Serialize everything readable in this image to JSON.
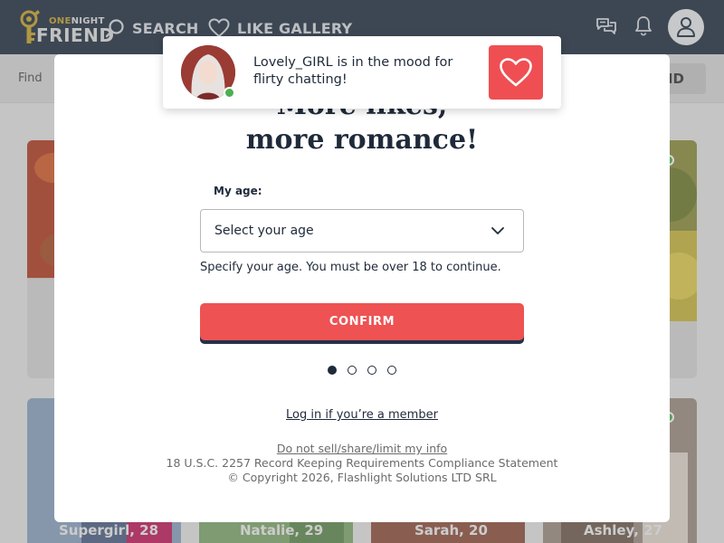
{
  "brand": {
    "logo_top_a": "ONE",
    "logo_top_b": "NIGHT",
    "logo_bottom": "FRIEND"
  },
  "nav": {
    "search_label": "SEARCH",
    "like_gallery_label": "LIKE GALLERY",
    "icons": [
      "search-icon",
      "heart-icon",
      "chat-icon",
      "bell-icon",
      "user-icon"
    ]
  },
  "subbar": {
    "find_label": "Find",
    "button_label_partial": "ID"
  },
  "cards": [
    {
      "name": "",
      "sub": ""
    },
    {
      "name": "",
      "sub": ""
    },
    {
      "name": "Supergirl, 28",
      "sub": ""
    },
    {
      "name": "Natalie, 29",
      "sub": ""
    },
    {
      "name": "Sarah, 20",
      "sub": ""
    },
    {
      "name": "Ashley, 27",
      "sub": ""
    }
  ],
  "modal": {
    "headline_line1": "More likes,",
    "headline_line2": "more romance!",
    "age_label": "My age:",
    "age_select_placeholder": "Select your age",
    "age_hint": "Specify your age. You must be over 18 to continue.",
    "confirm_label": "CONFIRM",
    "step_count": 4,
    "active_step": 1,
    "login_link": "Log in if you’re a member",
    "footer": {
      "do_not_sell": "Do not sell/share/limit my info",
      "compliance": "18 U.S.C. 2257 Record Keeping Requirements Compliance Statement",
      "copyright": "© Copyright 2026, Flashlight Solutions LTD SRL"
    }
  },
  "toast": {
    "message": "Lovely_GIRL is in the mood for flirty chatting!",
    "online": true
  },
  "colors": {
    "nav_bg": "#1e2d3f",
    "accent_red": "#ee5253",
    "text_dark": "#1f2a3a",
    "online_green": "#4caf50",
    "logo_gold": "#c9a227"
  }
}
